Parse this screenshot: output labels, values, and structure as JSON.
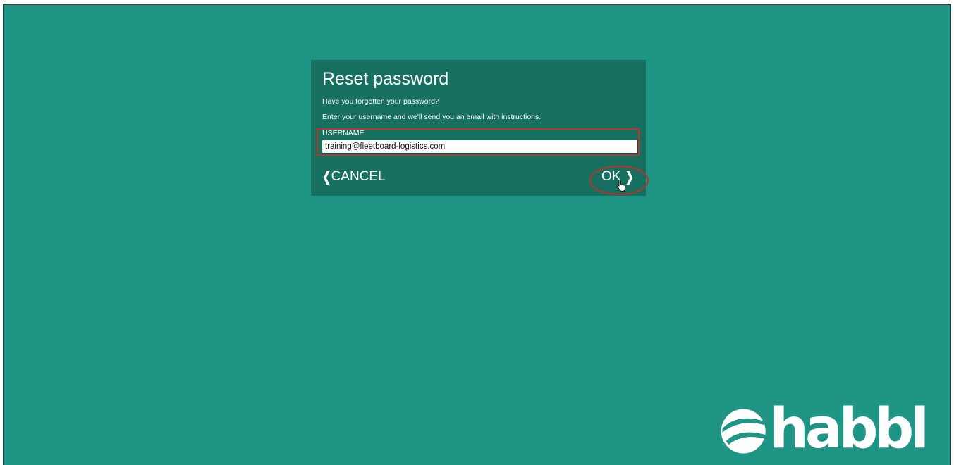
{
  "dialog": {
    "title": "Reset password",
    "line1": "Have you forgotten your password?",
    "line2": "Enter your username and we'll send you an email with instructions.",
    "username_label": "USERNAME",
    "username_value": "training@fleetboard-logistics.com",
    "cancel_label": "CANCEL",
    "ok_label": "OK"
  },
  "brand": {
    "name": "habbl"
  },
  "colors": {
    "background": "#1f9586",
    "dialog": "#17705f",
    "highlight": "#c0302a"
  }
}
